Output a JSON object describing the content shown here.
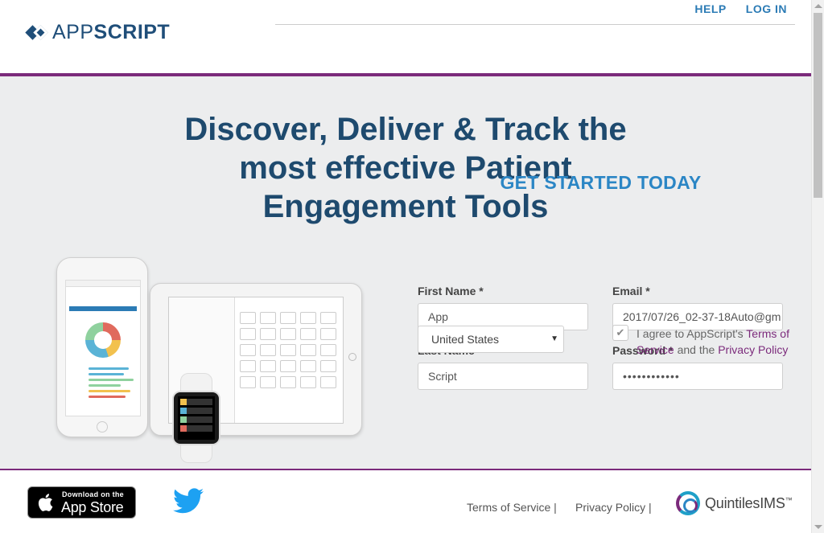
{
  "header": {
    "logo_app": "APP",
    "logo_script": "SCRIPT",
    "nav": {
      "help": "HELP",
      "login": "LOG IN"
    }
  },
  "hero": {
    "headline_lines": [
      "Discover, Deliver & Track the",
      "most effective Patient",
      "Engagement Tools"
    ]
  },
  "form": {
    "title": "GET STARTED TODAY",
    "first_name": {
      "label": "First Name *",
      "value": "App"
    },
    "email": {
      "label": "Email *",
      "value": "2017/07/26_02-37-18Auto@gm"
    },
    "last_name": {
      "label": "Last Name *",
      "value": "Script"
    },
    "password": {
      "label": "Password *",
      "value": "••••••••••••"
    },
    "country": {
      "selected": "United States"
    },
    "agree": {
      "prefix": "I agree to AppScript's ",
      "terms": "Terms of Service",
      "middle": " and the ",
      "privacy": "Privacy Policy",
      "checked": true
    }
  },
  "footer": {
    "appstore_small": "Download on the",
    "appstore_big": "App Store",
    "terms": "Terms of Service |",
    "privacy": "Privacy Policy |",
    "partner": "QuintilesIMS",
    "partner_tm": "™"
  },
  "colors": {
    "brand_blue": "#1f4e79",
    "accent_blue": "#2b86c5",
    "purple": "#7b2a7b",
    "hero_bg": "#ecedee"
  },
  "icons": {
    "logo": "appscript-logo-icon",
    "apple": "apple-icon",
    "twitter": "twitter-icon",
    "checkbox": "checkmark-icon",
    "select": "caret-down-icon"
  }
}
